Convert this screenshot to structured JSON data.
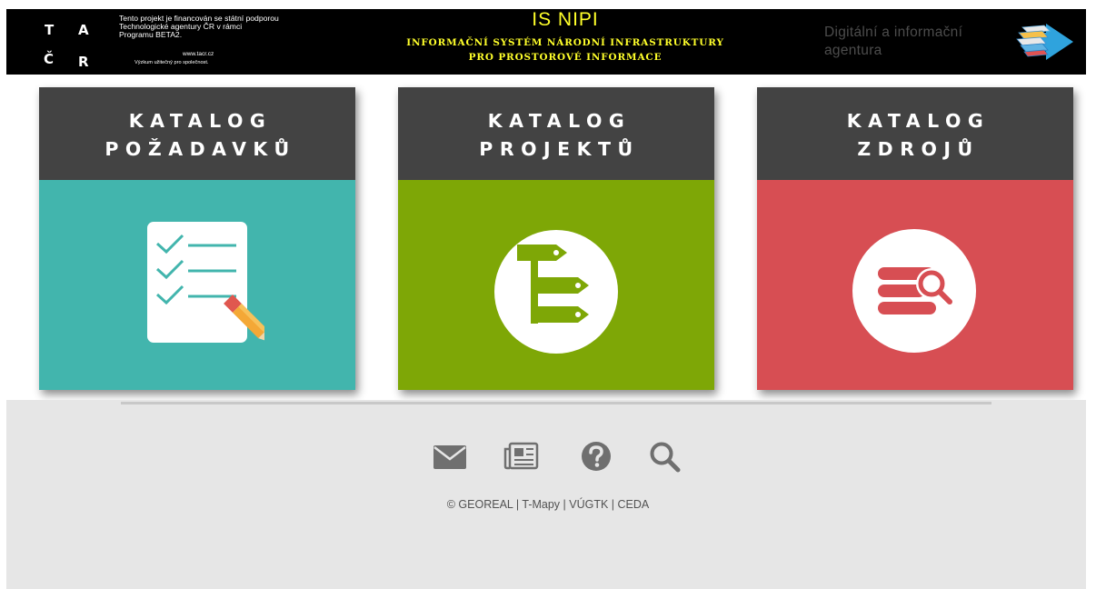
{
  "header": {
    "tacr": {
      "letters": [
        "T",
        "A",
        "Č",
        "R"
      ],
      "funding_line1": "Tento projekt je financován se státní podporou",
      "funding_line2": "Technologické agentury ČR v rámci",
      "funding_line3": "Programu BETA2.",
      "website": "www.tacr.cz",
      "slogan": "Výzkum užitečný pro společnost."
    },
    "title": "IS NIPI",
    "subtitle_line1": "INFORMAČNÍ SYSTÉM NÁRODNÍ INFRASTRUKTURY",
    "subtitle_line2": "PRO PROSTOROVÉ INFORMACE",
    "agency": {
      "line1": "Digitální a informační",
      "line2": "agentura",
      "logo_icon": "dia-arrow-logo-icon"
    },
    "title_color": "#ffff2a"
  },
  "catalogs": [
    {
      "title_line1": "KATALOG",
      "title_line2": "POŽADAVKŮ",
      "color": "#42b5ad",
      "icon": "checklist-pencil-icon"
    },
    {
      "title_line1": "KATALOG",
      "title_line2": "PROJEKTŮ",
      "color": "#7ea706",
      "icon": "project-tree-icon"
    },
    {
      "title_line1": "KATALOG",
      "title_line2": "ZDROJŮ",
      "color": "#d74e53",
      "icon": "database-search-icon"
    }
  ],
  "footer": {
    "icons": [
      "envelope-icon",
      "newspaper-icon",
      "question-circle-icon",
      "search-icon"
    ],
    "copyright": "© GEOREAL | T-Mapy | VÚGTK | CEDA"
  }
}
